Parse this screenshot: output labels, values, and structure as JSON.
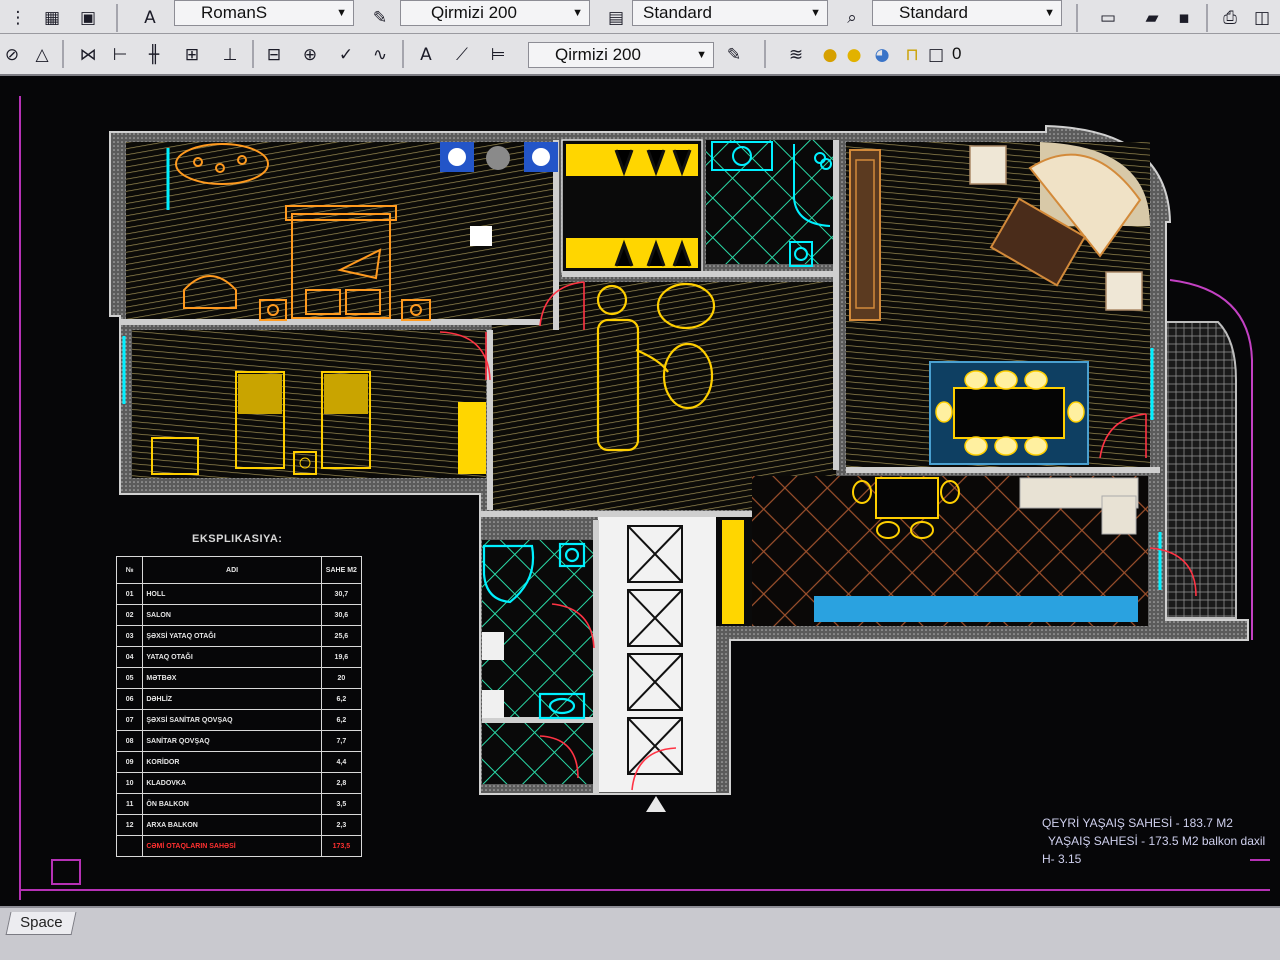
{
  "toolbar_top": {
    "text_style": "RomanS",
    "layer_color": "Qirmizi 200",
    "dim_style": "Standard",
    "table_style": "Standard"
  },
  "toolbar_second": {
    "layer_color": "Qirmizi 200",
    "layer_number": "0"
  },
  "legend": {
    "title": "EKSPLIKASIYA:",
    "headers": [
      "№",
      "ADI",
      "SAHE M2"
    ],
    "rows": [
      [
        "01",
        "HOLL",
        "30,7"
      ],
      [
        "02",
        "SALON",
        "30,6"
      ],
      [
        "03",
        "ŞƏXSİ YATAQ OTAĞI",
        "25,6"
      ],
      [
        "04",
        "YATAQ OTAĞI",
        "19,6"
      ],
      [
        "05",
        "MƏTBƏX",
        "20"
      ],
      [
        "06",
        "DƏHLİZ",
        "6,2"
      ],
      [
        "07",
        "ŞƏXSİ SANİTAR QOVŞAQ",
        "6,2"
      ],
      [
        "08",
        "SANİTAR QOVŞAQ",
        "7,7"
      ],
      [
        "09",
        "KORİDOR",
        "4,4"
      ],
      [
        "10",
        "KLADOVKA",
        "2,8"
      ],
      [
        "11",
        "ÖN BALKON",
        "3,5"
      ],
      [
        "12",
        "ARXA BALKON",
        "2,3"
      ]
    ],
    "total": [
      "",
      "CƏMİ OTAQLARIN SAHƏSİ",
      "173,5"
    ]
  },
  "area_notes": {
    "line1": "QEYRİ YAŞAIŞ SAHESİ - 183.7 M2",
    "line2": "YAŞAIŞ SAHESİ - 173.5 M2 balkon daxil",
    "line3": "H- 3.15"
  },
  "status": {
    "tab_label": "Space"
  },
  "colors": {
    "wall": "#c8c8c8",
    "floor_hatch": "#b9a86a",
    "furniture": "#ffb020",
    "yellow": "#ffe600",
    "cyan": "#00ffff",
    "magenta": "#c03cc0",
    "red": "#ff3333",
    "blue": "#2b7bff"
  }
}
